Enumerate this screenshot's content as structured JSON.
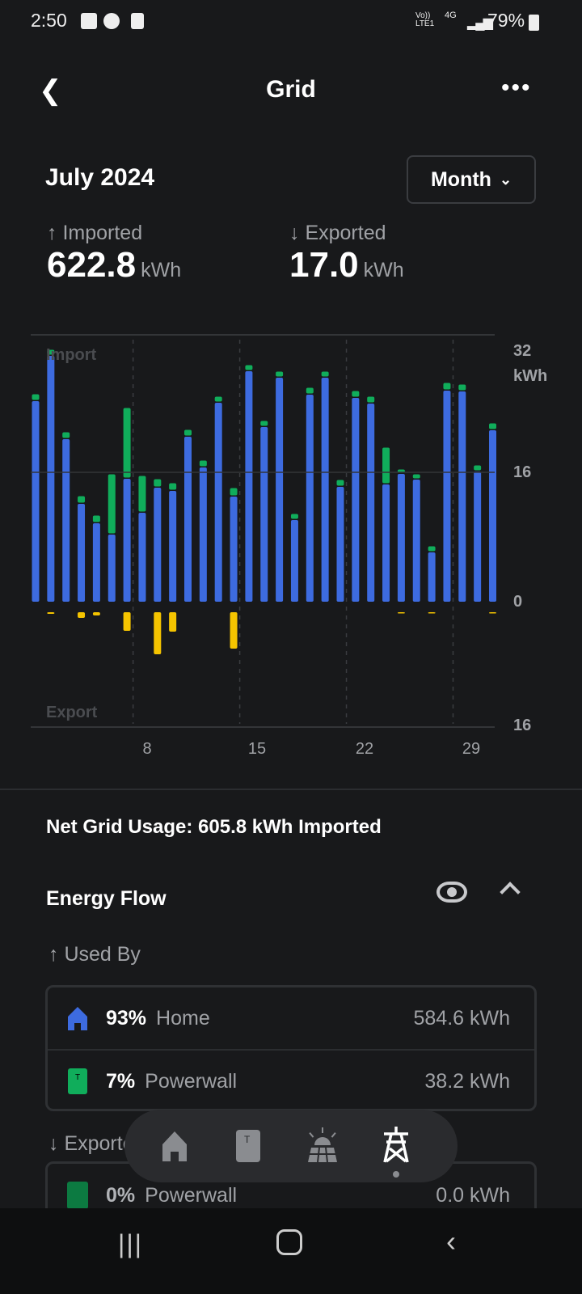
{
  "status_bar": {
    "time": "2:50",
    "network": "Vo)) LTE1",
    "net_type": "4G",
    "battery": "79%"
  },
  "header": {
    "title": "Grid",
    "back_icon": "chevron-left-icon",
    "more_icon": "more-horizontal-icon"
  },
  "period": {
    "label": "July 2024",
    "range_selector": "Month"
  },
  "summary": {
    "imported_label": "Imported",
    "imported_value": "622.8",
    "exported_label": "Exported",
    "exported_value": "17.0",
    "unit": "kWh"
  },
  "chart_data": {
    "type": "bar",
    "stacked": true,
    "x": [
      1,
      2,
      3,
      4,
      5,
      6,
      7,
      8,
      9,
      10,
      11,
      12,
      13,
      14,
      15,
      16,
      17,
      18,
      19,
      20,
      21,
      22,
      23,
      24,
      25,
      26,
      27,
      28,
      29,
      30,
      31
    ],
    "x_tick_labels": [
      "8",
      "15",
      "22",
      "29"
    ],
    "import_label": "Import",
    "export_label": "Export",
    "y_ticks_import": [
      "32",
      "16",
      "0"
    ],
    "y_unit": "kWh",
    "y_tick_export": "16",
    "ylim_import": [
      0,
      32
    ],
    "ylim_export": [
      0,
      16
    ],
    "series": [
      {
        "role": "import-home",
        "color": "#3d6be0",
        "values": [
          24.8,
          30.4,
          20.1,
          12.1,
          9.7,
          8.3,
          15.2,
          11,
          14.1,
          13.7,
          20.4,
          16.6,
          24.6,
          13,
          28.5,
          21.6,
          27.7,
          10.1,
          25.6,
          27.7,
          14.2,
          25.2,
          24.5,
          14.5,
          15.8,
          15.1,
          6.1,
          26.1,
          26,
          16.1,
          21.2
        ]
      },
      {
        "role": "import-powerwall",
        "color": "#10ad5b",
        "values": [
          0.7,
          0.6,
          0.7,
          0.8,
          0.8,
          7.3,
          8.6,
          4.4,
          0.9,
          0.8,
          0.7,
          0.7,
          0.6,
          0.9,
          0.6,
          0.6,
          0.6,
          0.6,
          0.7,
          0.6,
          0.7,
          0.7,
          0.7,
          4.4,
          0.4,
          0.5,
          0.6,
          0.8,
          0.7,
          0.6,
          0.7
        ]
      },
      {
        "role": "export",
        "color": "#f5c400",
        "values": [
          0,
          0.2,
          0,
          0.7,
          0.4,
          0,
          2.3,
          0,
          5.2,
          2.4,
          0,
          0,
          0,
          4.5,
          0,
          0,
          0,
          0,
          0,
          0,
          0,
          0,
          0,
          0,
          0.1,
          0,
          0.1,
          0,
          0,
          0,
          0.1
        ]
      }
    ]
  },
  "net_usage": "Net Grid Usage: 605.8 kWh Imported",
  "energy_flow": {
    "title": "Energy Flow",
    "used_by_label": "Used By",
    "used_by": [
      {
        "pct": "93%",
        "name": "Home",
        "value": "584.6 kWh",
        "icon": "home-icon",
        "color": "#3d6be0"
      },
      {
        "pct": "7%",
        "name": "Powerwall",
        "value": "38.2 kWh",
        "icon": "powerwall-icon",
        "color": "#10ad5b"
      }
    ],
    "exported_to_label": "Exported To",
    "exported_to": [
      {
        "pct": "0%",
        "name": "Powerwall",
        "value": "0.0 kWh"
      }
    ]
  },
  "bottom_nav": [
    {
      "icon": "home-icon"
    },
    {
      "icon": "powerwall-icon"
    },
    {
      "icon": "solar-icon"
    },
    {
      "icon": "grid-tower-icon",
      "active": true
    }
  ]
}
